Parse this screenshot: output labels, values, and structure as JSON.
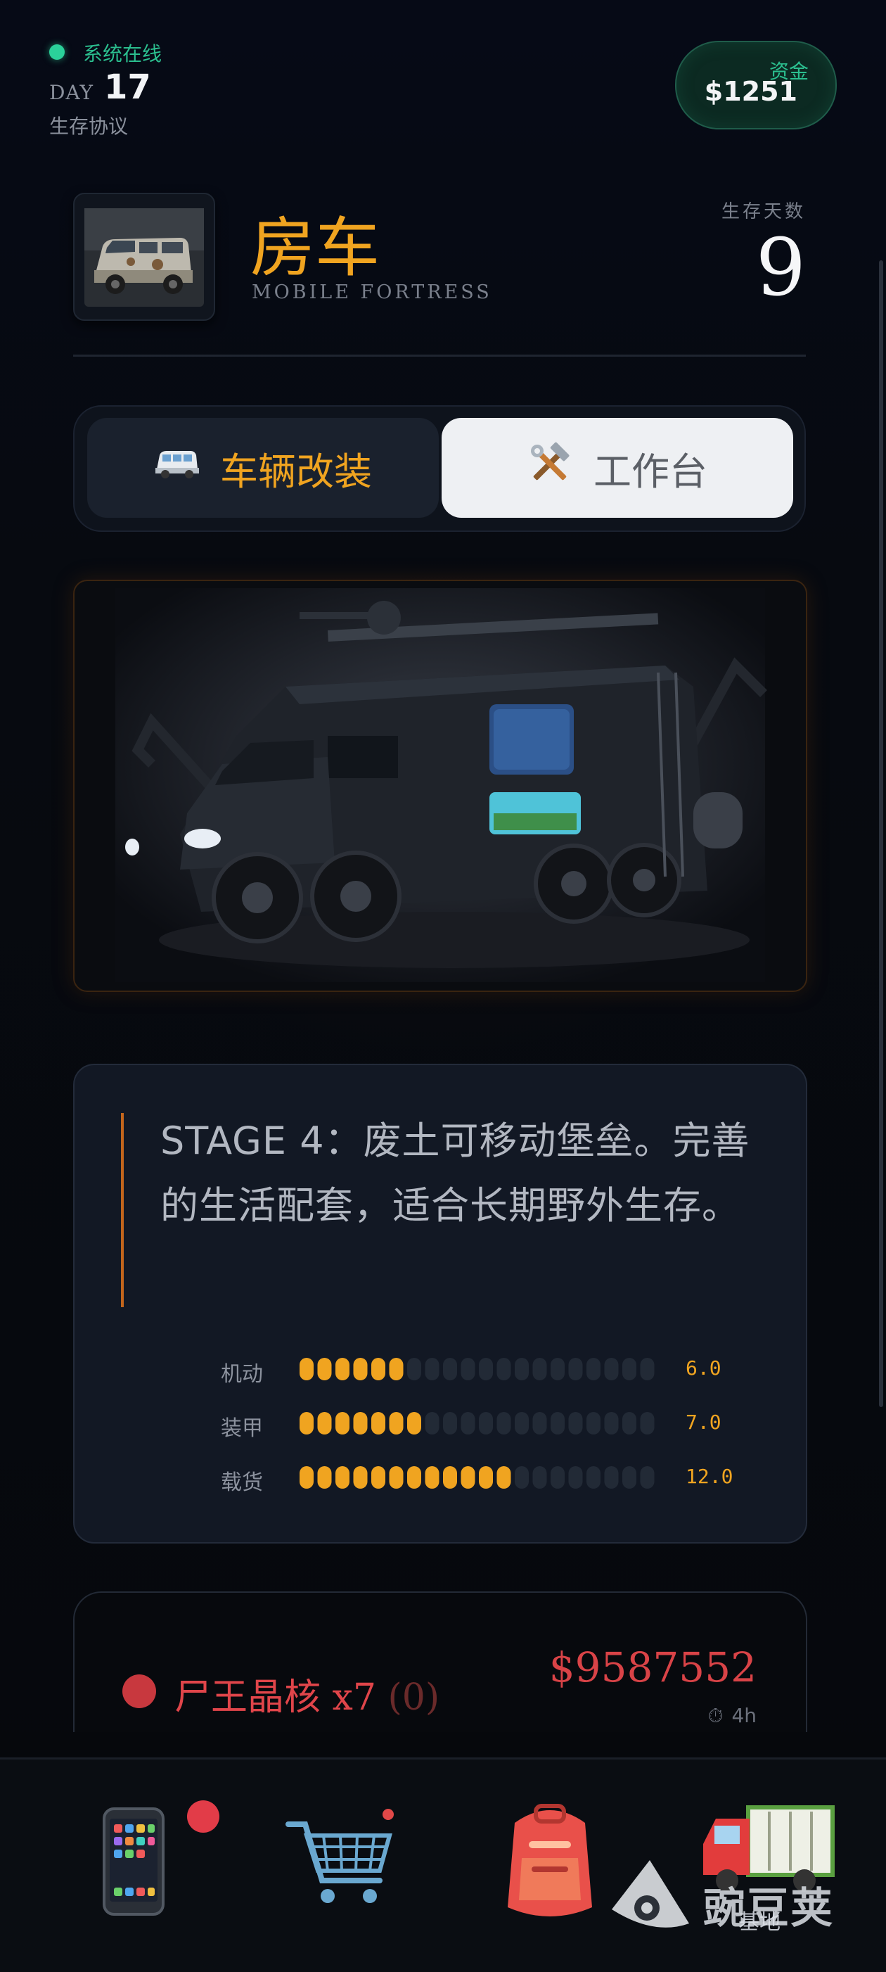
{
  "header": {
    "status": "系统在线",
    "day_label": "DAY",
    "day_value": "17",
    "protocol": "生存协议",
    "funds_label": "资金",
    "funds_value": "$1251"
  },
  "vehicle": {
    "title": "房车",
    "subtitle": "MOBILE FORTRESS",
    "days_label": "生存天数",
    "days_value": "9"
  },
  "tabs": [
    {
      "label": "车辆改装",
      "icon": "van-icon",
      "active": false
    },
    {
      "label": "工作台",
      "icon": "tools-icon",
      "active": true
    }
  ],
  "description": "STAGE 4：废土可移动堡垒。完善的生活配套，适合长期野外生存。",
  "stats": [
    {
      "label": "机动",
      "value": "6.0",
      "fill": 6
    },
    {
      "label": "装甲",
      "value": "7.0",
      "fill": 7
    },
    {
      "label": "载货",
      "value": "12.0",
      "fill": 12
    }
  ],
  "stat_segments_total": 20,
  "bounty": {
    "name": "尸王晶核 x7",
    "count": "(0)",
    "price": "$9587552",
    "time": "4h"
  },
  "nav": {
    "items": [
      "phone",
      "shop",
      "backpack",
      "base"
    ],
    "active_label": "基地"
  },
  "watermark": "豌豆荚",
  "colors": {
    "accent": "#f0a420",
    "online": "#2bd19a",
    "danger": "#d94347"
  }
}
